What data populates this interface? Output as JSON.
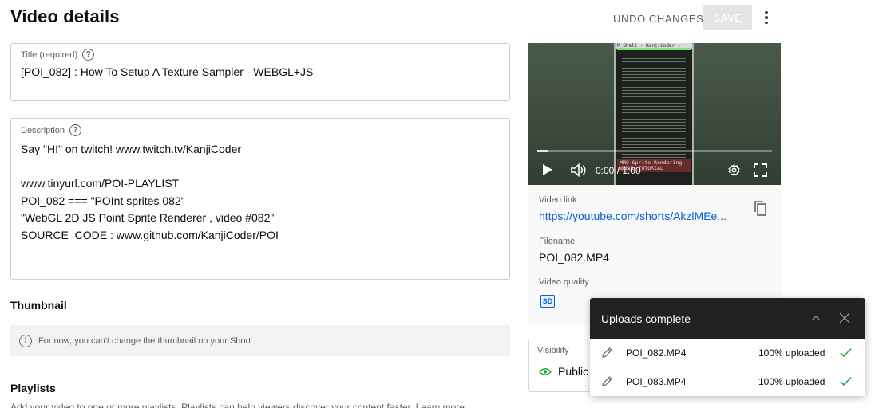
{
  "header": {
    "title": "Video details",
    "undo_label": "UNDO CHANGES",
    "save_label": "SAVE"
  },
  "title_field": {
    "label": "Title (required)",
    "value": "[POI_082] : How To Setup A Texture Sampler - WEBGL+JS"
  },
  "description_field": {
    "label": "Description",
    "lines": [
      "Say \"HI\" on twitch! www.twitch.tv/KanjiCoder",
      "",
      "www.tinyurl.com/POI-PLAYLIST",
      "POI_082 === \"POInt sprites 082\"",
      "\"WebGL 2D JS Point Sprite Renderer , video #082\"",
      "SOURCE_CODE : www.github.com/KanjiCoder/POI"
    ]
  },
  "thumbnail": {
    "heading": "Thumbnail",
    "note": "For now, you can't change the thumbnail on your Short"
  },
  "playlists": {
    "heading": "Playlists",
    "subtext": "Add your video to one or more playlists. Playlists can help viewers discover your content faster. Learn more"
  },
  "video": {
    "frame_title": "M Shell - KanjiCoder - POI_082",
    "frame_caption": "MMO Sprite Rendering WEBGL TUTORIAL",
    "time": "0:00 / 1:00",
    "progress": 0.05,
    "link_label": "Video link",
    "link": "https://youtube.com/shorts/AkzlMEe...",
    "filename_label": "Filename",
    "filename": "POI_082.MP4",
    "quality_label": "Video quality",
    "quality_badge": "SD"
  },
  "visibility": {
    "label": "Visibility",
    "value": "Public"
  },
  "uploads": {
    "title": "Uploads complete",
    "items": [
      {
        "name": "POI_082.MP4",
        "status": "100% uploaded"
      },
      {
        "name": "POI_083.MP4",
        "status": "100% uploaded"
      }
    ]
  },
  "colors": {
    "link_blue": "#065fd4",
    "success_green": "#2ba640",
    "panel_header": "#212121"
  },
  "icons": [
    "help-icon",
    "info-icon",
    "play-icon",
    "volume-icon",
    "gear-icon",
    "fullscreen-icon",
    "copy-icon",
    "eye-icon",
    "chevron-up-icon",
    "close-icon",
    "pencil-icon",
    "check-icon",
    "more-vert-icon"
  ]
}
